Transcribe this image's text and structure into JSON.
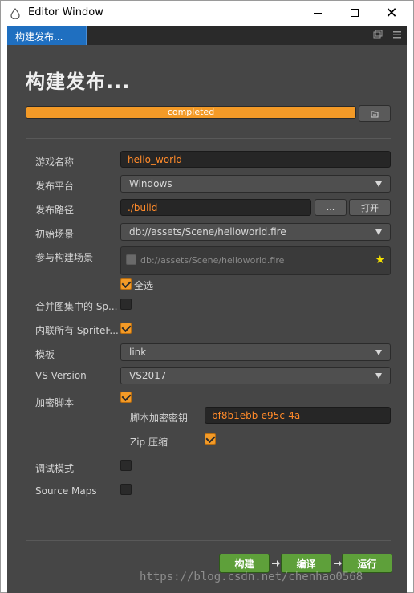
{
  "window": {
    "title": "Editor Window",
    "controls": {
      "minimize": "minimize",
      "maximize": "maximize",
      "close": "✕"
    }
  },
  "tab": {
    "label": "构建发布..."
  },
  "header": {
    "title": "构建发布..."
  },
  "progress": {
    "status": "completed",
    "percent": 100
  },
  "form": {
    "game_name": {
      "label": "游戏名称",
      "value": "hello_world"
    },
    "platform": {
      "label": "发布平台",
      "value": "Windows"
    },
    "build_path": {
      "label": "发布路径",
      "value": "./build",
      "browse_label": "...",
      "open_label": "打开"
    },
    "start_scene": {
      "label": "初始场景",
      "value": "db://assets/Scene/helloworld.fire"
    },
    "included_scenes": {
      "label": "参与构建场景",
      "items": [
        "db://assets/Scene/helloworld.fire"
      ],
      "select_all_label": "全选"
    },
    "merge_atlas": {
      "label": "合并图集中的 Sp...",
      "checked": false
    },
    "inline_sprite": {
      "label": "内联所有 SpriteF...",
      "checked": true
    },
    "template": {
      "label": "模板",
      "value": "link"
    },
    "vs_version": {
      "label": "VS Version",
      "value": "VS2017"
    },
    "encrypt": {
      "label": "加密脚本",
      "checked": true
    },
    "encrypt_key": {
      "label": "脚本加密密钥",
      "value": "bf8b1ebb-e95c-4a"
    },
    "zip": {
      "label": "Zip 压缩",
      "checked": true
    },
    "debug": {
      "label": "调试模式",
      "checked": false
    },
    "source_maps": {
      "label": "Source Maps",
      "checked": false
    }
  },
  "actions": {
    "build": "构建",
    "compile": "编译",
    "run": "运行"
  },
  "watermark": "https://blog.csdn.net/chenhao0568",
  "colors": {
    "accent": "#f39a27",
    "green": "#5ea03a",
    "tab_blue": "#1f6fc0",
    "panel": "#464646"
  }
}
